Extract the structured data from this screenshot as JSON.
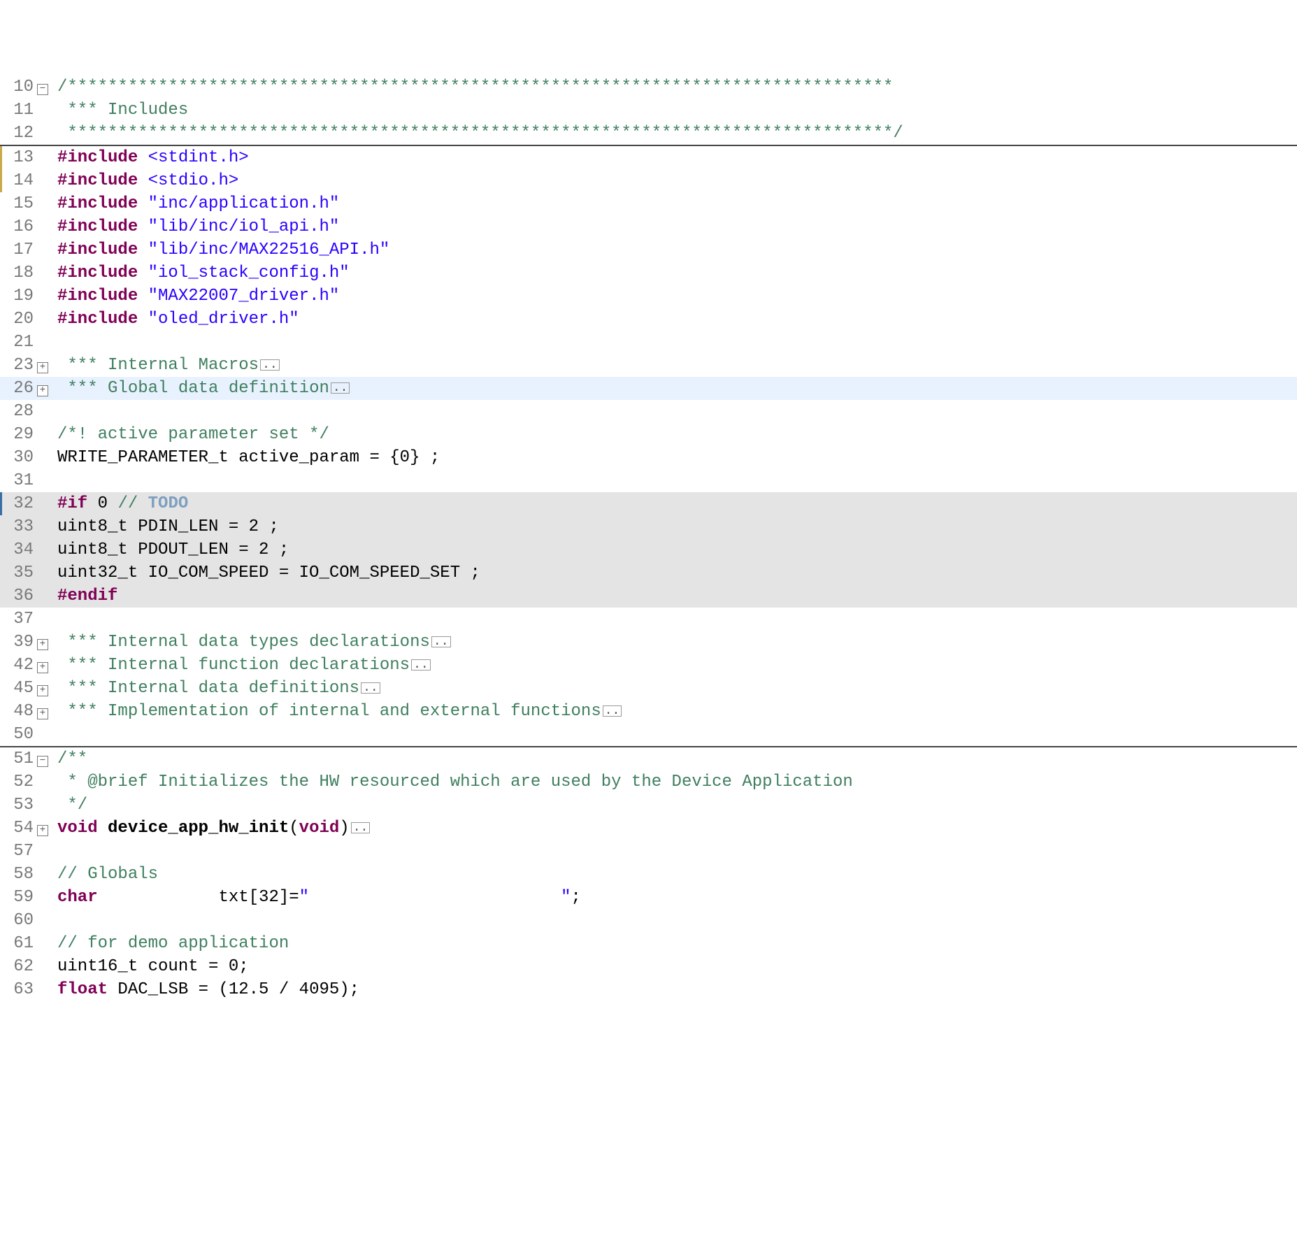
{
  "fold": {
    "plus": "+",
    "minus": "−",
    "ellipsis": ".."
  },
  "lines": {
    "l10": {
      "num": "10",
      "text": "/**********************************************************************************"
    },
    "l11": {
      "num": "11",
      "stars": " *** ",
      "text": "Includes"
    },
    "l12": {
      "num": "12",
      "text": " **********************************************************************************/"
    },
    "l13": {
      "num": "13",
      "inc": "#include",
      "arg": "<stdint.h>"
    },
    "l14": {
      "num": "14",
      "inc": "#include",
      "arg": "<stdio.h>"
    },
    "l15": {
      "num": "15",
      "inc": "#include",
      "arg": "\"inc/application.h\""
    },
    "l16": {
      "num": "16",
      "inc": "#include",
      "arg": "\"lib/inc/iol_api.h\""
    },
    "l17": {
      "num": "17",
      "inc": "#include",
      "arg": "\"lib/inc/MAX22516_API.h\""
    },
    "l18": {
      "num": "18",
      "inc": "#include",
      "arg": "\"iol_stack_config.h\""
    },
    "l19": {
      "num": "19",
      "inc": "#include",
      "arg": "\"MAX22007_driver.h\""
    },
    "l20": {
      "num": "20",
      "inc": "#include",
      "arg": "\"oled_driver.h\""
    },
    "l21": {
      "num": "21"
    },
    "l23": {
      "num": "23",
      "stars": " *** ",
      "text": "Internal Macros"
    },
    "l26": {
      "num": "26",
      "stars": " *** ",
      "text": "Global data definition"
    },
    "l28": {
      "num": "28"
    },
    "l29": {
      "num": "29",
      "text": "/*! active parameter set */"
    },
    "l30": {
      "num": "30",
      "text": "WRITE_PARAMETER_t active_param = {0} ;"
    },
    "l31": {
      "num": "31"
    },
    "l32": {
      "num": "32",
      "pp": "#if",
      "zero": " 0 ",
      "c": "// ",
      "todo": "TODO"
    },
    "l33": {
      "num": "33",
      "text": "uint8_t PDIN_LEN = 2 ;"
    },
    "l34": {
      "num": "34",
      "text": "uint8_t PDOUT_LEN = 2 ;"
    },
    "l35": {
      "num": "35",
      "text": "uint32_t IO_COM_SPEED = IO_COM_SPEED_SET ;"
    },
    "l36": {
      "num": "36",
      "pp": "#endif"
    },
    "l37": {
      "num": "37"
    },
    "l39": {
      "num": "39",
      "stars": " *** ",
      "text": "Internal data types declarations"
    },
    "l42": {
      "num": "42",
      "stars": " *** ",
      "text": "Internal function declarations"
    },
    "l45": {
      "num": "45",
      "stars": " *** ",
      "text": "Internal data definitions"
    },
    "l48": {
      "num": "48",
      "stars": " *** ",
      "text": "Implementation of internal and external functions"
    },
    "l50": {
      "num": "50"
    },
    "l51": {
      "num": "51",
      "text": "/**"
    },
    "l52": {
      "num": "52",
      "text": " * @brief Initializes the HW resourced which are used by the Device Application"
    },
    "l53": {
      "num": "53",
      "text": " */"
    },
    "l54": {
      "num": "54",
      "kw1": "void",
      "fn": " device_app_hw_init",
      "paren_open": "(",
      "kw2": "void",
      "paren_close": ")"
    },
    "l57": {
      "num": "57"
    },
    "l58": {
      "num": "58",
      "text": "// Globals"
    },
    "l59": {
      "num": "59",
      "kw": "char",
      "rest": "            txt[32]=",
      "str": "\"                         \"",
      "semi": ";"
    },
    "l60": {
      "num": "60"
    },
    "l61": {
      "num": "61",
      "text": "// for demo application"
    },
    "l62": {
      "num": "62",
      "text": "uint16_t count = 0;"
    },
    "l63": {
      "num": "63",
      "kw": "float",
      "rest": " DAC_LSB = (12.5 / 4095);"
    }
  }
}
